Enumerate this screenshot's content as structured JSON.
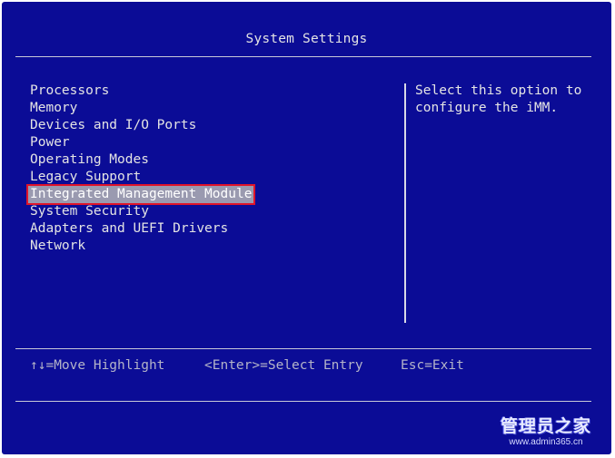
{
  "header": {
    "title": "System Settings"
  },
  "menu": {
    "items": [
      "Processors",
      "Memory",
      "Devices and I/O Ports",
      "Power",
      "Operating Modes",
      "Legacy Support",
      "Integrated Management Module",
      "System Security",
      "Adapters and UEFI Drivers",
      "Network"
    ],
    "selected_index": 6
  },
  "help": {
    "line1": "Select this option to",
    "line2": "configure the iMM."
  },
  "footer": {
    "nav": "↑↓=Move Highlight",
    "enter": "<Enter>=Select Entry",
    "esc": "Esc=Exit"
  },
  "watermark": {
    "name": "管理员之家",
    "url": "www.admin365.cn"
  },
  "colors": {
    "background": "#0b0c96",
    "text": "#e4e4e4",
    "highlight": "#9a9ab0",
    "highlight_border": "#e0142a"
  }
}
